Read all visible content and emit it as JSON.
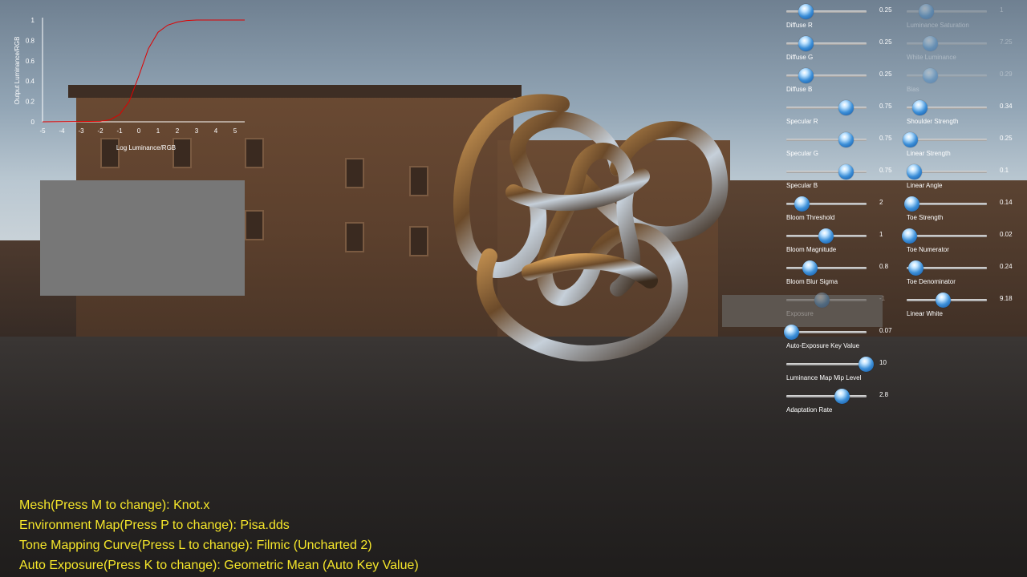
{
  "chart": {
    "y_ticks": [
      "1",
      "0.8",
      "0.6",
      "0.4",
      "0.2",
      "0"
    ],
    "x_ticks": [
      "-5",
      "-4",
      "-3",
      "-2",
      "-1",
      "0",
      "1",
      "2",
      "3",
      "4",
      "5"
    ],
    "xlabel": "Log Luminance/RGB",
    "ylabel": "Output Luminance/RGB",
    "curve_color": "#e00000"
  },
  "chart_data": {
    "type": "line",
    "xlabel": "Log Luminance/RGB",
    "ylabel": "Output Luminance/RGB",
    "xlim": [
      -5,
      5.5
    ],
    "ylim": [
      0,
      1
    ],
    "x_ticks": [
      -5,
      -4,
      -3,
      -2,
      -1,
      0,
      1,
      2,
      3,
      4,
      5
    ],
    "y_ticks": [
      0,
      0.2,
      0.4,
      0.6,
      0.8,
      1
    ],
    "grid": false,
    "x": [
      -5,
      -2,
      -1.5,
      -1,
      -0.5,
      0,
      0.5,
      1,
      1.5,
      2,
      2.5,
      3,
      5.5
    ],
    "y": [
      0,
      0.005,
      0.02,
      0.07,
      0.2,
      0.45,
      0.72,
      0.88,
      0.95,
      0.98,
      0.995,
      1,
      1
    ]
  },
  "sliders_left": [
    {
      "label": "Diffuse R",
      "value": "0.25",
      "pos": 0.25,
      "enabled": true
    },
    {
      "label": "Diffuse G",
      "value": "0.25",
      "pos": 0.25,
      "enabled": true
    },
    {
      "label": "Diffuse B",
      "value": "0.25",
      "pos": 0.25,
      "enabled": true
    },
    {
      "label": "Specular R",
      "value": "0.75",
      "pos": 0.75,
      "enabled": true
    },
    {
      "label": "Specular G",
      "value": "0.75",
      "pos": 0.75,
      "enabled": true
    },
    {
      "label": "Specular B",
      "value": "0.75",
      "pos": 0.75,
      "enabled": true
    },
    {
      "label": "Bloom Threshold",
      "value": "2",
      "pos": 0.2,
      "enabled": true
    },
    {
      "label": "Bloom Magnitude",
      "value": "1",
      "pos": 0.5,
      "enabled": true
    },
    {
      "label": "Bloom Blur Sigma",
      "value": "0.8",
      "pos": 0.3,
      "enabled": true
    },
    {
      "label": "Exposure",
      "value": "-1",
      "pos": 0.45,
      "enabled": false
    },
    {
      "label": "Auto-Exposure Key Value",
      "value": "0.07",
      "pos": 0.07,
      "enabled": true
    },
    {
      "label": "Luminance Map Mip Level",
      "value": "10",
      "pos": 1.0,
      "enabled": true
    },
    {
      "label": "Adaptation Rate",
      "value": "2.8",
      "pos": 0.7,
      "enabled": true
    }
  ],
  "sliders_right": [
    {
      "label": "Luminance Saturation",
      "value": "1",
      "pos": 0.25,
      "enabled": false
    },
    {
      "label": "White Luminance",
      "value": "7.25",
      "pos": 0.3,
      "enabled": false
    },
    {
      "label": "Bias",
      "value": "0.29",
      "pos": 0.3,
      "enabled": false
    },
    {
      "label": "Shoulder Strength",
      "value": "0.34",
      "pos": 0.17,
      "enabled": true
    },
    {
      "label": "Linear Strength",
      "value": "0.25",
      "pos": 0.05,
      "enabled": true
    },
    {
      "label": "Linear Angle",
      "value": "0.1",
      "pos": 0.1,
      "enabled": true
    },
    {
      "label": "Toe Strength",
      "value": "0.14",
      "pos": 0.07,
      "enabled": true
    },
    {
      "label": "Toe Numerator",
      "value": "0.02",
      "pos": 0.04,
      "enabled": true
    },
    {
      "label": "Toe Denominator",
      "value": "0.24",
      "pos": 0.12,
      "enabled": true
    },
    {
      "label": "Linear White",
      "value": "9.18",
      "pos": 0.46,
      "enabled": true
    }
  ],
  "info": {
    "mesh": "Mesh(Press M to change): Knot.x",
    "env": "Environment Map(Press P to change): Pisa.dds",
    "tone": "Tone Mapping Curve(Press L to change): Filmic (Uncharted 2)",
    "auto": "Auto Exposure(Press K to change): Geometric Mean (Auto Key Value)"
  },
  "colors": {
    "info_text": "#f5e62a",
    "slider_thumb": "#3c8fd8",
    "curve": "#e00000"
  }
}
